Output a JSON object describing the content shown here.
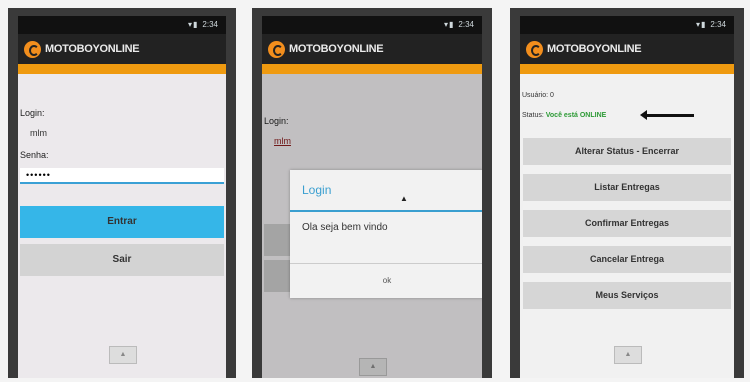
{
  "status_time": "2:34",
  "app_title": "MOTOBOYONLINE",
  "screen1": {
    "login_label": "Login:",
    "login_value": "mlm",
    "password_label": "Senha:",
    "password_value": "••••••",
    "enter_button": "Entrar",
    "exit_button": "Sair"
  },
  "screen2": {
    "login_label": "Login:",
    "login_value": "mlm",
    "dialog_title": "Login",
    "dialog_message": "Ola seja bem vindo",
    "dialog_ok": "ok"
  },
  "screen3": {
    "user_line": "Usuário: 0",
    "status_prefix": "Status:",
    "status_value": "Você está ONLINE",
    "buttons": [
      "Alterar Status - Encerrar",
      "Listar Entregas",
      "Confirmar Entregas",
      "Cancelar Entrega",
      "Meus Serviços"
    ]
  },
  "colors": {
    "accent_orange": "#ef9a10",
    "primary_blue": "#35b6e8",
    "online_green": "#2e9b37"
  },
  "icons": [
    "logo-icon",
    "signal-icon",
    "battery-icon",
    "home-nav-icon",
    "mouse-cursor-icon",
    "arrow-annotation-icon"
  ]
}
